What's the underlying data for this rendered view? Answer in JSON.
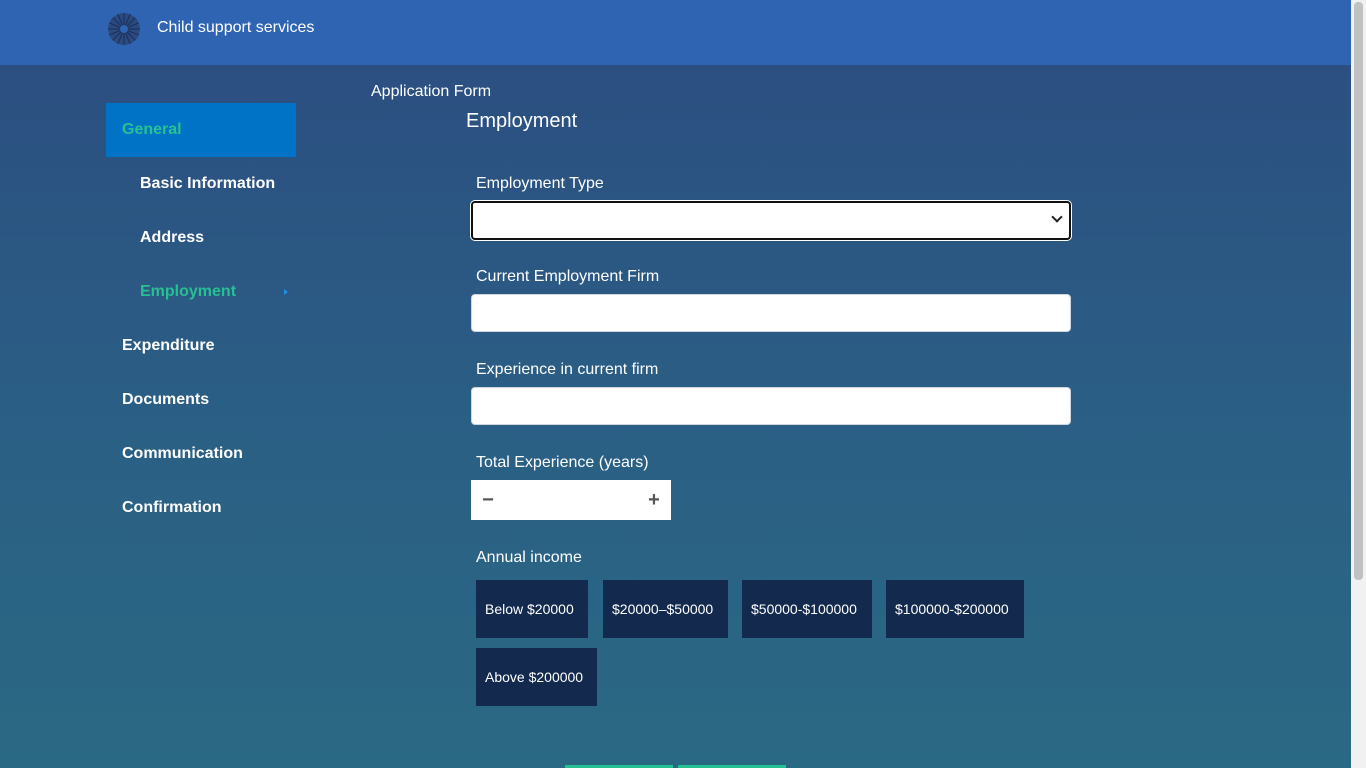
{
  "header": {
    "app_title": "Child support services",
    "logo_icon": "sunburst-logo-icon"
  },
  "sidebar": {
    "items": [
      {
        "label": "General",
        "state": "active-group"
      },
      {
        "label": "Basic Information",
        "state": "sub"
      },
      {
        "label": "Address",
        "state": "sub"
      },
      {
        "label": "Employment",
        "state": "current"
      },
      {
        "label": "Expenditure",
        "state": ""
      },
      {
        "label": "Documents",
        "state": ""
      },
      {
        "label": "Communication",
        "state": ""
      },
      {
        "label": "Confirmation",
        "state": ""
      }
    ]
  },
  "main": {
    "breadcrumb": "Application Form",
    "section_title": "Employment",
    "fields": {
      "employment_type": {
        "label": "Employment Type",
        "value": ""
      },
      "current_firm": {
        "label": "Current Employment Firm",
        "value": ""
      },
      "experience_current": {
        "label": "Experience in current firm",
        "value": ""
      },
      "total_experience": {
        "label": "Total Experience (years)",
        "value": "",
        "minus": "−",
        "plus": "+"
      }
    },
    "annual_income": {
      "label": "Annual income",
      "options": [
        "Below $20000",
        "$20000–$50000",
        "$50000-$100000",
        "$100000-$200000",
        "Above $200000"
      ]
    }
  },
  "colors": {
    "accent_green": "#27c093",
    "active_blue": "#0073c7",
    "topbar": "#2f64b3",
    "income_button": "#13294e"
  }
}
